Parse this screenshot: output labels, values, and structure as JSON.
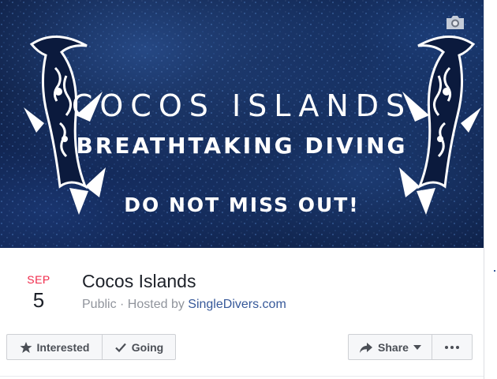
{
  "cover": {
    "title": "COCOS ISLANDS",
    "subtitle": "BREATHTAKING DIVING",
    "cta": "DO NOT MISS OUT!",
    "background_color": "#0b1a3d",
    "text_color": "#ffffff",
    "camera_icon": "camera-icon"
  },
  "event": {
    "month": "SEP",
    "day": "5",
    "title": "Cocos Islands",
    "privacy": "Public",
    "separator": " · ",
    "hosted_by_prefix": "Hosted by ",
    "host": "SingleDivers.com"
  },
  "actions": {
    "interested_label": "Interested",
    "interested_icon": "star-icon",
    "going_label": "Going",
    "going_icon": "checkmark-icon",
    "share_label": "Share",
    "share_icon": "share-arrow-icon",
    "share_dropdown_icon": "caret-down-icon",
    "more_icon": "ellipsis-icon"
  },
  "colors": {
    "month": "#f02849",
    "link": "#365899",
    "meta": "#90949c",
    "button_text": "#4b4f56"
  }
}
